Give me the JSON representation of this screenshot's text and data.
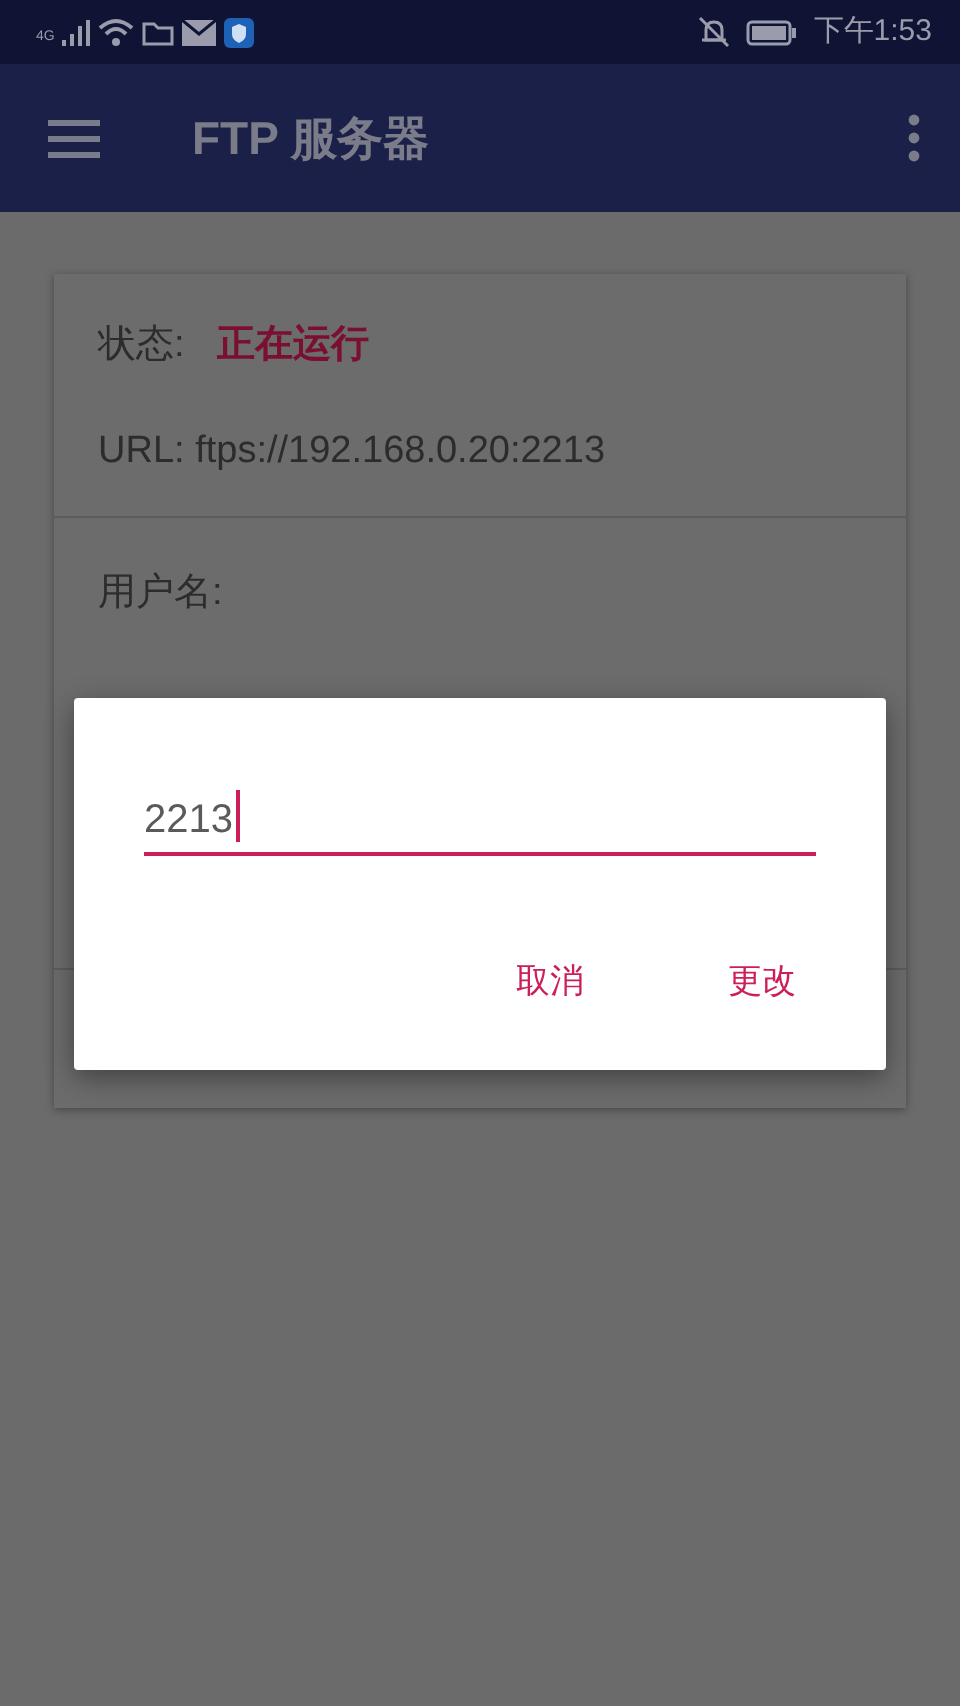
{
  "status_bar": {
    "network": "4G",
    "time": "下午1:53"
  },
  "app_bar": {
    "title": "FTP 服务器"
  },
  "server_card": {
    "status_label": "状态:",
    "status_value": "正在运行",
    "url": "URL: ftps://192.168.0.20:2213",
    "username_label": "用户名:"
  },
  "dialog": {
    "value": "2213",
    "buttons": [
      "取消",
      "更改"
    ]
  }
}
